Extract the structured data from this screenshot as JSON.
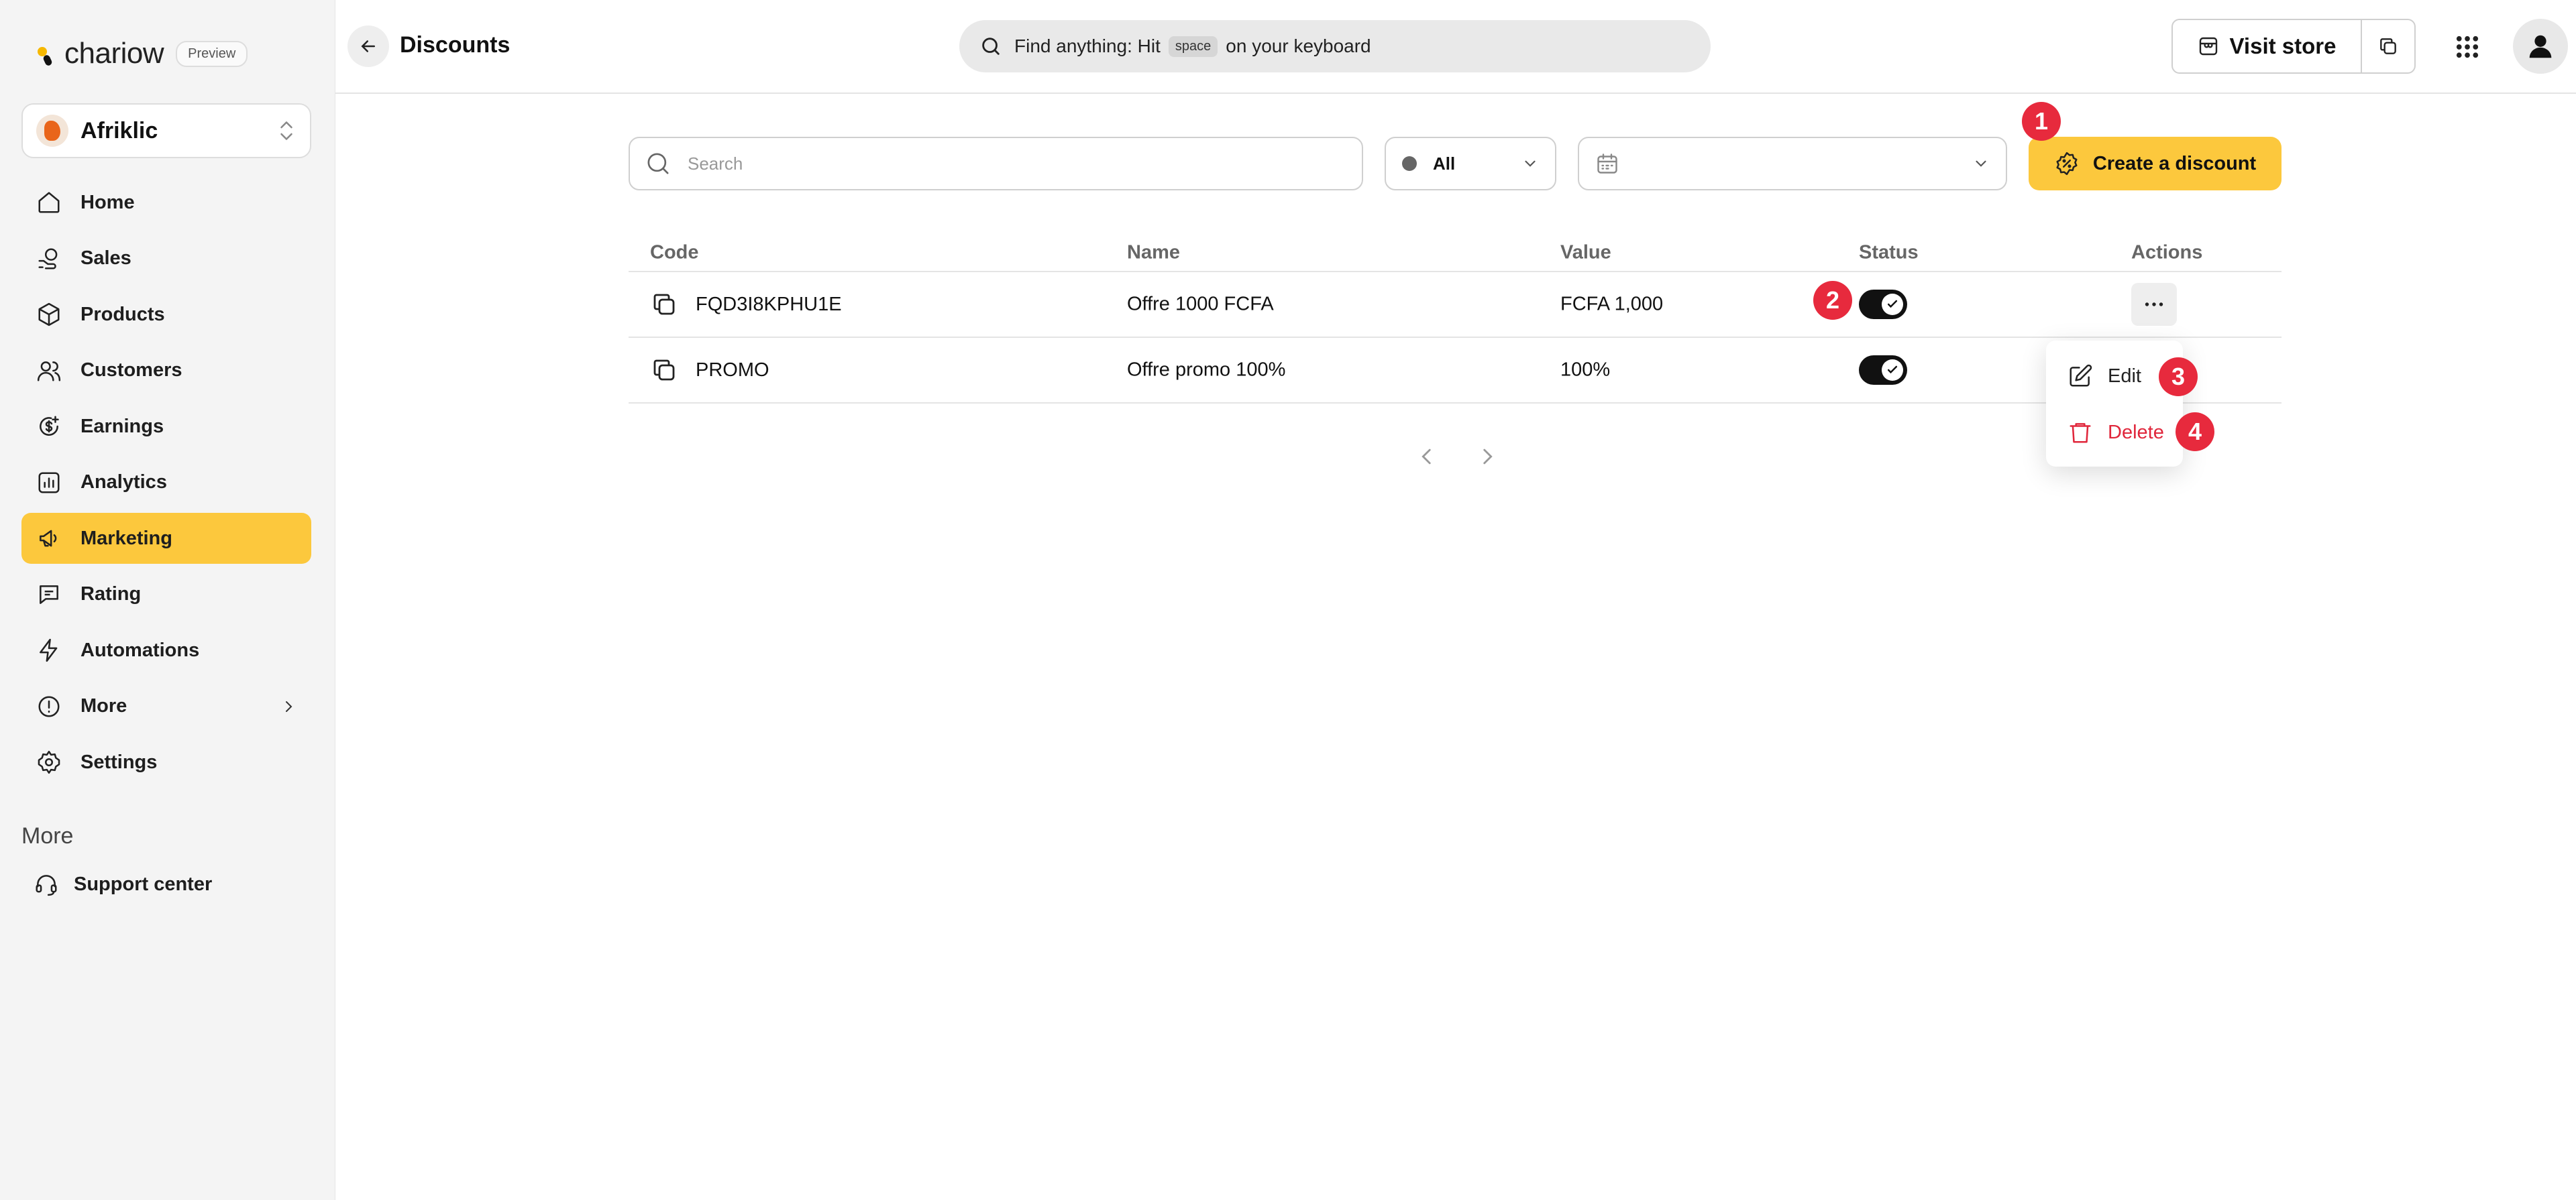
{
  "brand": {
    "name": "chariow",
    "badge": "Preview"
  },
  "store": {
    "name": "Afriklic"
  },
  "nav": [
    {
      "label": "Home",
      "icon": "home-icon"
    },
    {
      "label": "Sales",
      "icon": "sales-icon"
    },
    {
      "label": "Products",
      "icon": "box-icon"
    },
    {
      "label": "Customers",
      "icon": "users-icon"
    },
    {
      "label": "Earnings",
      "icon": "coin-icon"
    },
    {
      "label": "Analytics",
      "icon": "chart-icon"
    },
    {
      "label": "Marketing",
      "icon": "megaphone-icon",
      "active": true
    },
    {
      "label": "Rating",
      "icon": "chat-icon"
    },
    {
      "label": "Automations",
      "icon": "bolt-icon"
    },
    {
      "label": "More",
      "icon": "info-icon"
    },
    {
      "label": "Settings",
      "icon": "gear-icon"
    }
  ],
  "sidebar_more": {
    "heading": "More",
    "support": "Support center"
  },
  "header": {
    "title": "Discounts",
    "search_prefix": "Find anything: Hit",
    "search_key": "space",
    "search_suffix": "on your keyboard",
    "visit_store": "Visit store"
  },
  "toolbar": {
    "search_placeholder": "Search",
    "status_filter": "All",
    "create_label": "Create a discount"
  },
  "table": {
    "headers": {
      "code": "Code",
      "name": "Name",
      "value": "Value",
      "status": "Status",
      "actions": "Actions"
    },
    "rows": [
      {
        "code": "FQD3I8KPHU1E",
        "name": "Offre 1000 FCFA",
        "value": "FCFA 1,000",
        "enabled": true
      },
      {
        "code": "PROMO",
        "name": "Offre promo 100%",
        "value": "100%",
        "enabled": true
      }
    ]
  },
  "menu": {
    "edit": "Edit",
    "delete": "Delete"
  },
  "badges": [
    "1",
    "2",
    "3",
    "4"
  ],
  "colors": {
    "accent": "#fcc83d",
    "danger": "#e0263b",
    "badge": "#e72a3d"
  }
}
